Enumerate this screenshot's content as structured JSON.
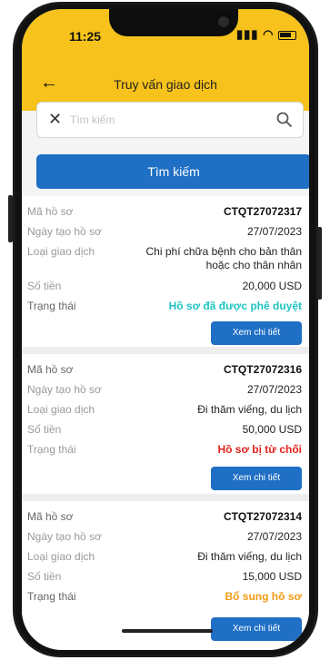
{
  "status_bar": {
    "time": "11:25"
  },
  "header": {
    "back_icon": "arrow-left-icon",
    "title": "Truy vấn giao dịch"
  },
  "search": {
    "placeholder": "Tìm kiếm",
    "button_label": "Tìm kiếm"
  },
  "labels": {
    "code": "Mã hồ sơ",
    "created": "Ngày tạo hồ sơ",
    "type": "Loại giao dịch",
    "amount": "Số tiền",
    "status": "Trạng thái",
    "detail_button": "Xem chi tiết"
  },
  "records": [
    {
      "code": "CTQT27072317",
      "created": "27/07/2023",
      "type_line1": "Chi phí chữa bệnh cho bản thân",
      "type_line2": "hoặc cho thân nhân",
      "amount": "20,000 USD",
      "status": "Hồ sơ đã được phê duyệt",
      "status_color": "#1fc4c4"
    },
    {
      "code": "CTQT27072316",
      "created": "27/07/2023",
      "type_line1": "Đi thăm viếng, du lịch",
      "amount": "50,000 USD",
      "status": "Hồ sơ bị từ chối",
      "status_color": "#e2211c"
    },
    {
      "code": "CTQT27072314",
      "created": "27/07/2023",
      "type_line1": "Đi thăm viếng, du lịch",
      "amount": "15,000 USD",
      "status": "Bổ sung hồ sơ",
      "status_color": "#f39a13"
    }
  ],
  "colors": {
    "header": "#f6c21b",
    "primary": "#1f6fc4"
  }
}
